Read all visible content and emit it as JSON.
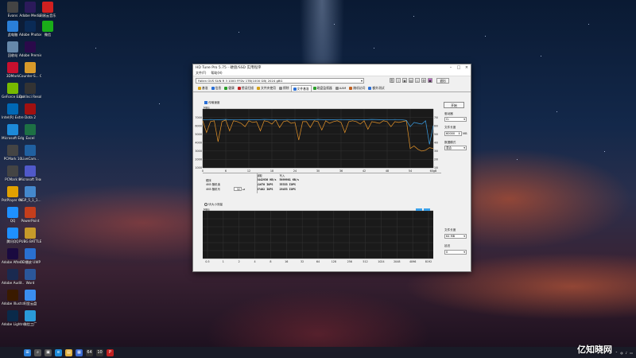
{
  "desktop": {
    "icons": [
      {
        "label": "Evans",
        "color": "#444"
      },
      {
        "label": "Adobe Media",
        "color": "#2b1a5a"
      },
      {
        "label": "网易云音乐",
        "color": "#d02020"
      },
      {
        "label": "此电脑",
        "color": "#2a7fd8"
      },
      {
        "label": "Adobe Photosh...",
        "color": "#0a2a55"
      },
      {
        "label": "微信",
        "color": "#1aad19"
      },
      {
        "label": "回收站",
        "color": "#6688aa"
      },
      {
        "label": "Adobe Premie...",
        "color": "#2a0a4a"
      },
      {
        "label": "3DMark",
        "color": "#c8102e"
      },
      {
        "label": "Counter-S... Global Off...",
        "color": "#d89a2a"
      },
      {
        "label": "GeForce Experience",
        "color": "#76b900"
      },
      {
        "label": "DaVinci Resolve",
        "color": "#333"
      },
      {
        "label": "Intel(R) Extre...",
        "color": "#0068b5"
      },
      {
        "label": "Dota 2",
        "color": "#a01010"
      },
      {
        "label": "Microsoft Edge",
        "color": "#1d8ad8"
      },
      {
        "label": "Excel",
        "color": "#1d7044"
      },
      {
        "label": "PCMark 10",
        "color": "#444"
      },
      {
        "label": "LiveCam...",
        "color": "#2060a0"
      },
      {
        "label": "PCMark 8",
        "color": "#444"
      },
      {
        "label": "Microsoft Teams",
        "color": "#5059c9"
      },
      {
        "label": "PotPlayer 64 bit",
        "color": "#e0a000"
      },
      {
        "label": "NGP_5_1_1...",
        "color": "#4488cc"
      },
      {
        "label": "QQ",
        "color": "#1e90ff"
      },
      {
        "label": "PowerPoint",
        "color": "#c43e1c"
      },
      {
        "label": "腾讯QQ",
        "color": "#1e90ff"
      },
      {
        "label": "PUBG BATTLEGR...",
        "color": "#c89a2a"
      },
      {
        "label": "Adobe After Effects 2022",
        "color": "#1a0a40"
      },
      {
        "label": "OO播放 UWP",
        "color": "#2a70d0"
      },
      {
        "label": "Adobe Audit...",
        "color": "#1a2a50"
      },
      {
        "label": "Word",
        "color": "#2b579a"
      },
      {
        "label": "Adobe Illustrat...",
        "color": "#3a1a00"
      },
      {
        "label": "阿里云盘",
        "color": "#3a8ef0"
      },
      {
        "label": "Adobe Lightroom...",
        "color": "#0a2a4a"
      },
      {
        "label": "微信工厂",
        "color": "#2a9ad8"
      }
    ]
  },
  "window": {
    "title": "HD Tune Pro 5.75 - 硬盘/SSD 实用程序",
    "menu": [
      "文件(F)",
      "帮助(H)"
    ],
    "device": "Fallen GVS SUN R 3 1000 FFDv 1TB(1000 GB) 2024 gBG",
    "exit_label": "退出",
    "tabs": [
      {
        "label": "基准",
        "color": "#d4a017"
      },
      {
        "label": "信息",
        "color": "#2a6fd6"
      },
      {
        "label": "健康",
        "color": "#2aa02a"
      },
      {
        "label": "错误扫描",
        "color": "#c02020"
      },
      {
        "label": "文件夹使用",
        "color": "#d4a017"
      },
      {
        "label": "擦除",
        "color": "#888"
      },
      {
        "label": "文件基准",
        "color": "#2a6fd6"
      },
      {
        "label": "磁盘监视器",
        "color": "#2aa02a"
      },
      {
        "label": "AAM",
        "color": "#888"
      },
      {
        "label": "随机访问",
        "color": "#c06020"
      },
      {
        "label": "额外测试",
        "color": "#2a6fd6"
      }
    ],
    "active_tab": 6
  },
  "upper": {
    "checkbox_label": "传输速度",
    "y_unit": "MB/s",
    "y_ticks": [
      "7000",
      "6000",
      "5000",
      "4000",
      "3000",
      "2000",
      "1000"
    ],
    "x_ticks": [
      "0",
      "6",
      "12",
      "18",
      "24",
      "30",
      "36",
      "42",
      "48",
      "54",
      "60gB"
    ],
    "right_ticks": [
      "700",
      "600",
      "500",
      "400",
      "300",
      "200",
      "100"
    ]
  },
  "sidebar": {
    "start_label": "开始",
    "drive_label": "驱动器",
    "drive_value": "G:",
    "filelen_label": "文件长度",
    "filelen_value": "60000",
    "filelen_unit": "MB",
    "pattern_label": "数据模式",
    "pattern_value": "混合",
    "filesize_label": "文件长度",
    "filesize_value": "64 MB",
    "delay_label": "延迟",
    "delay_value": "0"
  },
  "results": {
    "header_read": "读取",
    "header_write": "写入",
    "rows": [
      {
        "label": "顺序",
        "read": "5442930 KB/s",
        "write": "5699981 KB/s"
      },
      {
        "label": "4KB 随机读",
        "read": "11670 IOPS",
        "write": "35333 IOPS"
      },
      {
        "label": "4KB 随机写",
        "read": "97402 IOPS",
        "write": "29453 IOPS"
      }
    ],
    "queue_value": "32"
  },
  "lower": {
    "radio_label": "块大小测量",
    "y_unit": "MB/s",
    "x_ticks": [
      "0.5",
      "1",
      "2",
      "4",
      "8",
      "16",
      "32",
      "64",
      "128",
      "256",
      "512",
      "1024",
      "2048",
      "4096",
      "8192"
    ]
  },
  "chart_data": {
    "type": "line",
    "xlabel": "",
    "ylabel": "MB/s",
    "xlim": [
      0,
      60
    ],
    "ylim": [
      0,
      7000
    ],
    "series": [
      {
        "name": "",
        "color": "#e8962a",
        "x": [
          0,
          1,
          2,
          3,
          4,
          5,
          6,
          7,
          8,
          9,
          10,
          11,
          12,
          13,
          14,
          15,
          16,
          17,
          18,
          19,
          20,
          21,
          22,
          23,
          24,
          25,
          26,
          27,
          28,
          29,
          30,
          31,
          32,
          33,
          34,
          35,
          36,
          37,
          38,
          39,
          40,
          41,
          42,
          43,
          44,
          45,
          46,
          47,
          48,
          49,
          50,
          51,
          52,
          53,
          54,
          55,
          56,
          57,
          58,
          59,
          60
        ],
        "y": [
          5600,
          4200,
          5500,
          5600,
          3100,
          5500,
          5700,
          4400,
          5600,
          5500,
          5300,
          4900,
          5600,
          5400,
          5500,
          4400,
          5600,
          5500,
          5200,
          5700,
          4800,
          5500,
          5600,
          5300,
          5400,
          3300,
          5500,
          5500,
          4800,
          5600,
          5500,
          4500,
          5600,
          5300,
          5500,
          5600,
          5400,
          4200,
          5500,
          5600,
          5500,
          5200,
          5600,
          4600,
          5500,
          5400,
          5300,
          5600,
          5500,
          4900,
          5500,
          5400,
          5500,
          5600,
          2300,
          2600,
          2200,
          2000,
          2100,
          2400,
          2300
        ]
      },
      {
        "name": "",
        "color": "#3aa0e8",
        "x": [
          0,
          2,
          4,
          6,
          8,
          10,
          12,
          14,
          16,
          18,
          20,
          22,
          24,
          26,
          28,
          30,
          32,
          34,
          36,
          38,
          40,
          42,
          44,
          46,
          48,
          50,
          52,
          53,
          54,
          55,
          56,
          57,
          58,
          59,
          60
        ],
        "y": [
          5700,
          5750,
          5720,
          5760,
          5700,
          5740,
          5720,
          5710,
          5760,
          5730,
          5700,
          5750,
          5720,
          5740,
          5710,
          5760,
          5720,
          5730,
          5750,
          5710,
          5740,
          5720,
          5760,
          5730,
          5700,
          5750,
          5700,
          5650,
          4900,
          5400,
          5300,
          5200,
          5600,
          2800,
          5000
        ]
      }
    ]
  },
  "taskbar": {
    "icons": [
      {
        "name": "start-icon",
        "glyph": "⊞",
        "color": "#2a7fd8"
      },
      {
        "name": "search-icon",
        "glyph": "⌕",
        "color": "#555"
      },
      {
        "name": "taskview-icon",
        "glyph": "▣",
        "color": "#555"
      },
      {
        "name": "edge-icon",
        "glyph": "e",
        "color": "#1d8ad8"
      },
      {
        "name": "explorer-icon",
        "glyph": "▤",
        "color": "#e0b040"
      },
      {
        "name": "store-icon",
        "glyph": "▦",
        "color": "#3a6ad0"
      },
      {
        "name": "app-icon",
        "glyph": "64",
        "color": "#333"
      },
      {
        "name": "app2-icon",
        "glyph": "10",
        "color": "#333"
      },
      {
        "name": "app3-icon",
        "glyph": "P",
        "color": "#c02020"
      }
    ],
    "watermark": "亿知晓网"
  }
}
